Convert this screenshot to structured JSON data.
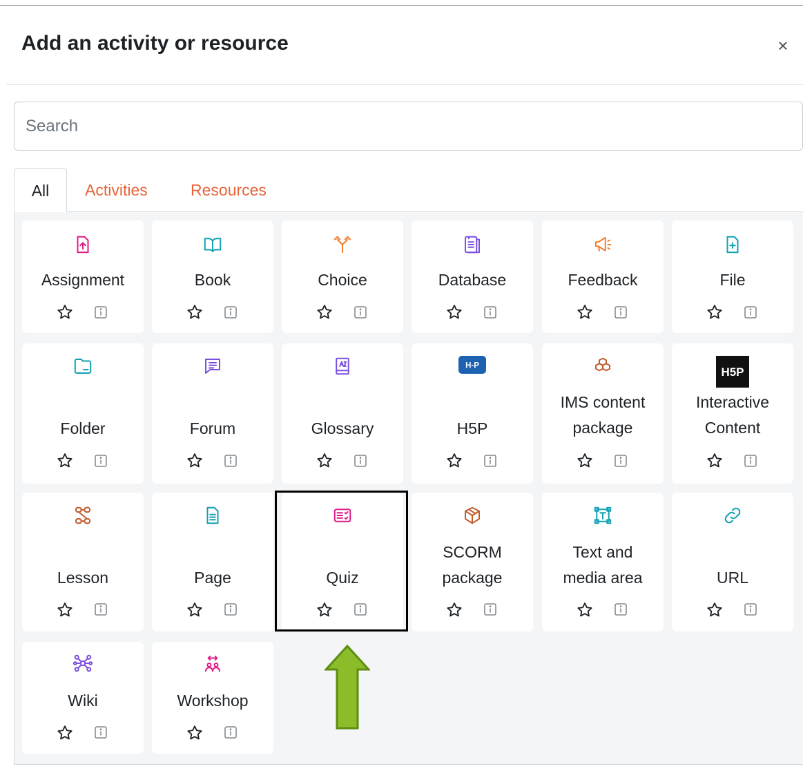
{
  "dialog": {
    "title": "Add an activity or resource",
    "close_label": "×"
  },
  "search": {
    "placeholder": "Search",
    "value": ""
  },
  "tabs": [
    {
      "label": "All",
      "active": true
    },
    {
      "label": "Activities",
      "active": false
    },
    {
      "label": "Resources",
      "active": false
    }
  ],
  "colors": {
    "tab_inactive": "#e8643a",
    "assessment_pink": "#e01b85",
    "collaboration_purple": "#7b4fe0",
    "content_teal": "#13a1b4",
    "communication_orange": "#f47c2c",
    "interactive_brown": "#c25b2c",
    "h5p_blue": "#1d62b0",
    "highlight_arrow": "#8bbd2a"
  },
  "items": [
    {
      "name": "Assignment",
      "icon": "assignment-icon"
    },
    {
      "name": "Book",
      "icon": "book-icon"
    },
    {
      "name": "Choice",
      "icon": "choice-icon"
    },
    {
      "name": "Database",
      "icon": "database-icon"
    },
    {
      "name": "Feedback",
      "icon": "feedback-icon"
    },
    {
      "name": "File",
      "icon": "file-icon"
    },
    {
      "name": "Folder",
      "icon": "folder-icon"
    },
    {
      "name": "Forum",
      "icon": "forum-icon"
    },
    {
      "name": "Glossary",
      "icon": "glossary-icon"
    },
    {
      "name": "H5P",
      "icon": "h5p-icon"
    },
    {
      "name": "IMS content package",
      "icon": "ims-package-icon"
    },
    {
      "name": "Interactive Content",
      "icon": "h5p-dark-icon"
    },
    {
      "name": "Lesson",
      "icon": "lesson-icon"
    },
    {
      "name": "Page",
      "icon": "page-icon"
    },
    {
      "name": "Quiz",
      "icon": "quiz-icon"
    },
    {
      "name": "SCORM package",
      "icon": "scorm-icon"
    },
    {
      "name": "Text and media area",
      "icon": "text-media-icon"
    },
    {
      "name": "URL",
      "icon": "url-icon"
    },
    {
      "name": "Wiki",
      "icon": "wiki-icon"
    },
    {
      "name": "Workshop",
      "icon": "workshop-icon"
    }
  ],
  "h5p_badge_text": "H-P",
  "h5p_dark_badge_text": "H5P",
  "highlighted_item": "Quiz"
}
